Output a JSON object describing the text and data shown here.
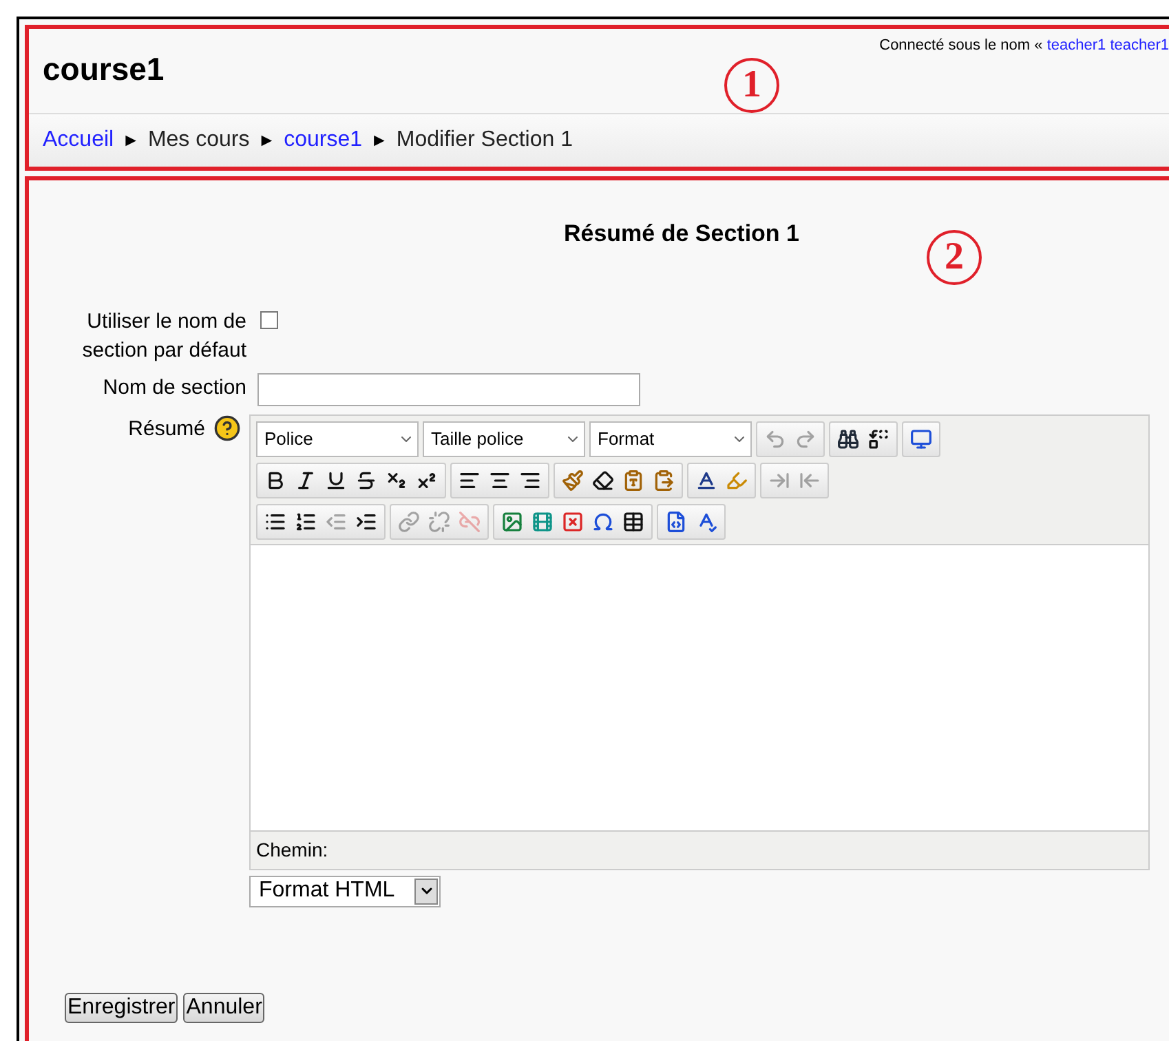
{
  "header": {
    "title": "course1",
    "login_prefix": "Connecté sous le nom «",
    "login_user": "teacher1 teacher1",
    "annotation": "1"
  },
  "breadcrumb": [
    {
      "label": "Accueil",
      "link": true
    },
    {
      "label": "Mes cours",
      "link": false
    },
    {
      "label": "course1",
      "link": true
    },
    {
      "label": "Modifier Section 1",
      "link": false
    }
  ],
  "breadcrumb_separator": "►",
  "form": {
    "heading": "Résumé de Section 1",
    "annotation": "2",
    "default_name": {
      "label": "Utiliser le nom de section par défaut",
      "checked": false
    },
    "section_name": {
      "label": "Nom de section"
    },
    "summary_label": "Résumé",
    "editor": {
      "dropdowns": [
        "Police",
        "Taille police",
        "Format"
      ],
      "toolbar_rows": [
        [
          [
            {
              "kind": "undo",
              "disabled": true
            },
            {
              "kind": "redo",
              "disabled": true
            }
          ],
          [
            {
              "kind": "find",
              "disabled": false
            },
            {
              "kind": "replace",
              "disabled": false
            }
          ],
          [
            {
              "kind": "fullscreen",
              "disabled": false
            }
          ]
        ],
        [
          [
            {
              "kind": "bold",
              "disabled": false
            },
            {
              "kind": "italic",
              "disabled": false
            },
            {
              "kind": "underline",
              "disabled": false
            },
            {
              "kind": "strike",
              "disabled": false
            },
            {
              "kind": "sub",
              "disabled": false
            },
            {
              "kind": "sup",
              "disabled": false
            }
          ],
          [
            {
              "kind": "alignleft",
              "disabled": false
            },
            {
              "kind": "aligncenter",
              "disabled": false
            },
            {
              "kind": "alignright",
              "disabled": false
            }
          ],
          [
            {
              "kind": "cleanup",
              "disabled": false
            },
            {
              "kind": "erase",
              "disabled": false
            },
            {
              "kind": "pastetext",
              "disabled": false
            },
            {
              "kind": "pasteword",
              "disabled": false
            }
          ],
          [
            {
              "kind": "fontcolor",
              "disabled": false
            },
            {
              "kind": "highlight",
              "disabled": false
            }
          ],
          [
            {
              "kind": "ltr",
              "disabled": true
            },
            {
              "kind": "rtl",
              "disabled": true
            }
          ]
        ],
        [
          [
            {
              "kind": "bullets",
              "disabled": false
            },
            {
              "kind": "numbers",
              "disabled": false
            },
            {
              "kind": "outdent",
              "disabled": true
            },
            {
              "kind": "indent",
              "disabled": false
            }
          ],
          [
            {
              "kind": "link",
              "disabled": true
            },
            {
              "kind": "unlink",
              "disabled": true
            },
            {
              "kind": "nolink",
              "disabled": true
            }
          ],
          [
            {
              "kind": "image",
              "disabled": false
            },
            {
              "kind": "media",
              "disabled": false
            },
            {
              "kind": "nonbreaking",
              "disabled": false
            },
            {
              "kind": "charmap",
              "disabled": false
            },
            {
              "kind": "table",
              "disabled": false
            }
          ],
          [
            {
              "kind": "html",
              "disabled": false
            },
            {
              "kind": "spell",
              "disabled": false
            }
          ]
        ]
      ],
      "path_label": "Chemin:"
    },
    "format_select": "Format HTML",
    "buttons": [
      "Enregistrer",
      "Annuler"
    ]
  }
}
